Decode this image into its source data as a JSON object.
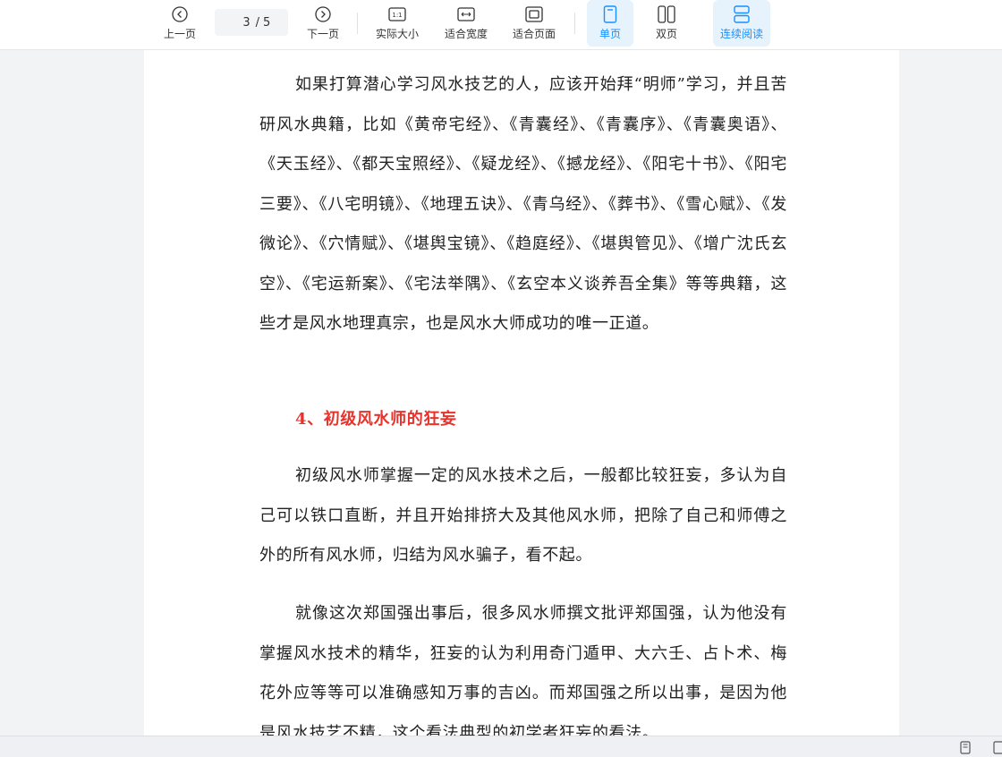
{
  "toolbar": {
    "prev_label": "上一页",
    "next_label": "下一页",
    "current_page": "3",
    "page_sep": "/",
    "total_pages": "5",
    "actual_size_label": "实际大小",
    "fit_width_label": "适合宽度",
    "fit_page_label": "适合页面",
    "single_page_label": "单页",
    "double_page_label": "双页",
    "continuous_label": "连续阅读",
    "actual_size_glyph": "1:1",
    "active_color": "#1890ff"
  },
  "document": {
    "paragraph_1": "如果打算潜心学习风水技艺的人，应该开始拜“明师”学习，并且苦研风水典籍，比如《黄帝宅经》、《青囊经》、《青囊序》、《青囊奥语》、《天玉经》、《都天宝照经》、《疑龙经》、《撼龙经》、《阳宅十书》、《阳宅三要》、《八宅明镜》、《地理五诀》、《青乌经》、《葬书》、《雪心赋》、《发微论》、《穴情赋》、《堪舆宝镜》、《趋庭经》、《堪舆管见》、《增广沈氏玄空》、《宅运新案》、《宅法举隅》、《玄空本义谈养吾全集》等等典籍，这些才是风水地理真宗，也是风水大师成功的唯一正道。",
    "heading": "4、初级风水师的狂妄",
    "heading_color": "#e8332c",
    "paragraph_2": "初级风水师掌握一定的风水技术之后，一般都比较狂妄，多认为自己可以铁口直断，并且开始排挤大及其他风水师，把除了自己和师傅之外的所有风水师，归结为风水骗子，看不起。",
    "paragraph_3": "就像这次郑国强出事后，很多风水师撰文批评郑国强，认为他没有掌握风水技术的精华，狂妄的认为利用奇门遁甲、大六壬、占卜术、梅花外应等等可以准确感知万事的吉凶。而郑国强之所以出事，是因为他是风水技艺不精，这个看法典型的初学者狂妄的看法。"
  }
}
